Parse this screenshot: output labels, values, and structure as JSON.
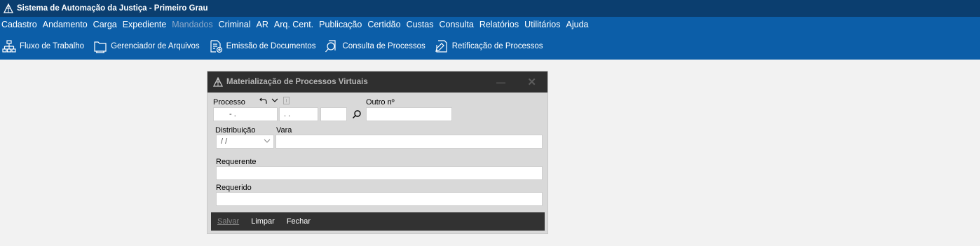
{
  "app": {
    "title": "Sistema de Automação da Justiça - Primeiro Grau",
    "icon": "tjs-logo-icon"
  },
  "menu": [
    {
      "label": "Cadastro",
      "disabled": false
    },
    {
      "label": "Andamento",
      "disabled": false
    },
    {
      "label": "Carga",
      "disabled": false
    },
    {
      "label": "Expediente",
      "disabled": false
    },
    {
      "label": "Mandados",
      "disabled": true
    },
    {
      "label": "Criminal",
      "disabled": false
    },
    {
      "label": "AR",
      "disabled": false
    },
    {
      "label": "Arq. Cent.",
      "disabled": false
    },
    {
      "label": "Publicação",
      "disabled": false
    },
    {
      "label": "Certidão",
      "disabled": false
    },
    {
      "label": "Custas",
      "disabled": false
    },
    {
      "label": "Consulta",
      "disabled": false
    },
    {
      "label": "Relatórios",
      "disabled": false
    },
    {
      "label": "Utilitários",
      "disabled": false
    },
    {
      "label": "Ajuda",
      "disabled": false
    }
  ],
  "toolbar": [
    {
      "label": "Fluxo de Trabalho",
      "icon": "workflow-icon"
    },
    {
      "label": "Gerenciador de Arquivos",
      "icon": "file-manager-icon"
    },
    {
      "label": "Emissão de Documentos",
      "icon": "document-emission-icon"
    },
    {
      "label": "Consulta de Processos",
      "icon": "process-search-icon"
    },
    {
      "label": "Retificação de Processos",
      "icon": "process-edit-icon"
    }
  ],
  "dialog": {
    "title": "Materialização de Processos Virtuais",
    "minimize": "—",
    "close": "✕",
    "processo_label": "Processo",
    "processo_part1": "- .",
    "processo_part2": ". .",
    "processo_part3": "",
    "outro_label": "Outro nº",
    "outro_value": "",
    "distribuicao_label": "Distribuição",
    "distribuicao_value": "/ /",
    "vara_label": "Vara",
    "vara_value": "",
    "requerente_label": "Requerente",
    "requerente_value": "",
    "requerido_label": "Requerido",
    "requerido_value": "",
    "buttons": {
      "salvar": {
        "label": "Salvar",
        "disabled": true
      },
      "limpar": {
        "label": "Limpar",
        "disabled": false
      },
      "fechar": {
        "label": "Fechar",
        "disabled": false
      }
    }
  }
}
